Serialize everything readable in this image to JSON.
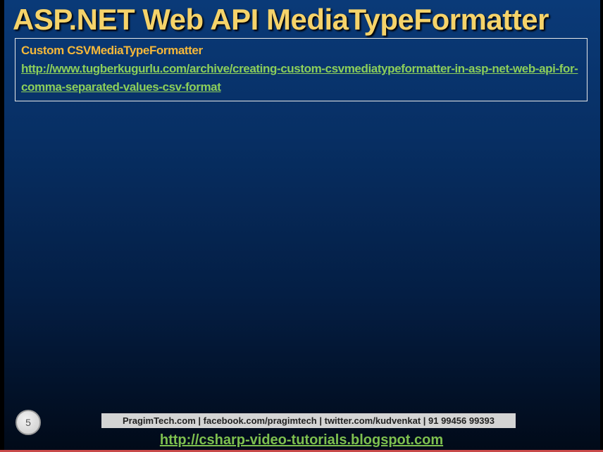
{
  "slide": {
    "title": "ASP.NET Web API MediaTypeFormatter",
    "box": {
      "heading": "Custom CSVMediaTypeFormatter",
      "link": "http://www.tugberkugurlu.com/archive/creating-custom-csvmediatypeformatter-in-asp-net-web-api-for-comma-separated-values-csv-format"
    },
    "slide_number": "5"
  },
  "footer": {
    "contact_text": "PragimTech.com | facebook.com/pragimtech  | twitter.com/kudvenkat  | 91 99456 99393",
    "blog_link": "http://csharp-video-tutorials.blogspot.com"
  },
  "colors": {
    "title": "#f5d36a",
    "heading": "#f5b83a",
    "link": "#8ccf5a",
    "background_top": "#0a3a78",
    "background_bottom": "#010a18"
  }
}
